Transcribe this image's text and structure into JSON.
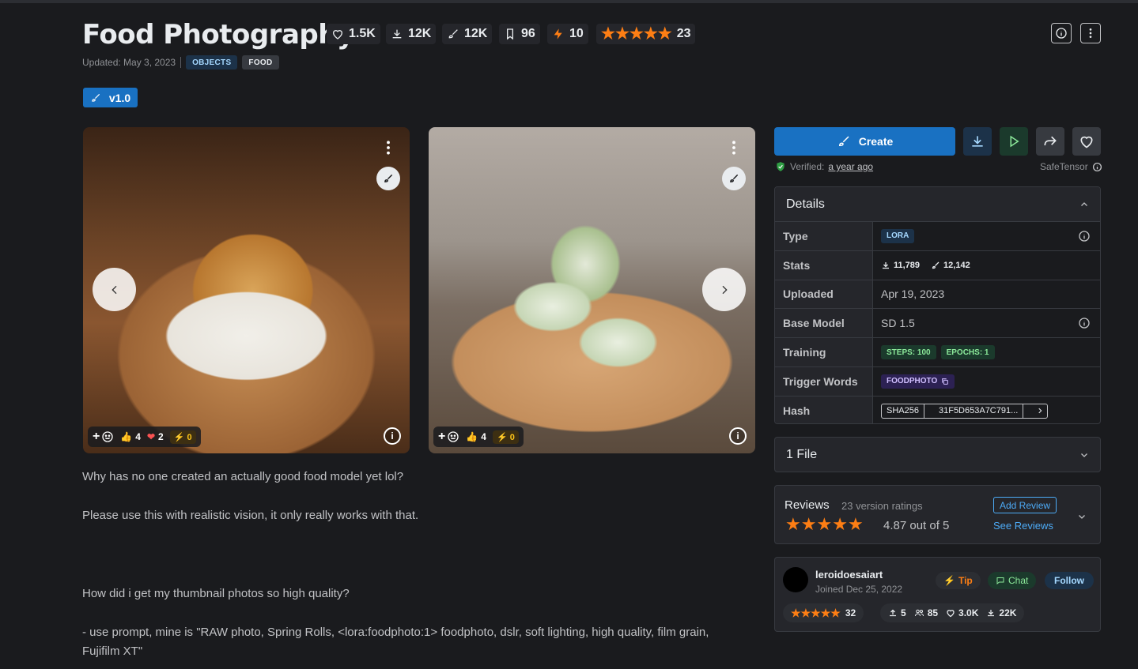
{
  "model": {
    "title": "Food Photography",
    "stats": {
      "likes": "1.5K",
      "downloads": "12K",
      "generations": "12K",
      "bookmarks": "96",
      "buzz": "10",
      "rating_count": "23"
    },
    "updated": "Updated: May 3, 2023",
    "tags": [
      "OBJECTS",
      "FOOD"
    ],
    "version": "v1.0"
  },
  "gallery": {
    "images": [
      {
        "alt": "waffle stack",
        "reactions": {
          "likes": "4",
          "hearts": "2",
          "buzz": "0"
        }
      },
      {
        "alt": "spring rolls",
        "reactions": {
          "likes": "4",
          "buzz": "0"
        }
      }
    ]
  },
  "description": {
    "p1": "Why has no one created an actually good food model yet lol?",
    "p2": "Please use this with realistic vision, it only really works with that.",
    "p3": "How did i get my thumbnail photos so high quality?",
    "p4": "- use prompt, mine is \"RAW photo, Spring Rolls, <lora:foodphoto:1> foodphoto, dslr, soft lighting, high quality, film grain, Fujifilm XT\""
  },
  "actions": {
    "create_label": "Create",
    "verified_label": "Verified:",
    "verified_time": "a year ago",
    "safetensor": "SafeTensor"
  },
  "details": {
    "heading": "Details",
    "type_label": "Type",
    "type_value": "LORA",
    "stats_label": "Stats",
    "stats_downloads": "11,789",
    "stats_generations": "12,142",
    "uploaded_label": "Uploaded",
    "uploaded_value": "Apr 19, 2023",
    "base_label": "Base Model",
    "base_value": "SD 1.5",
    "training_label": "Training",
    "training_steps": "STEPS: 100",
    "training_epochs": "EPOCHS: 1",
    "trigger_label": "Trigger Words",
    "trigger_value": "FOODPHOTO",
    "hash_label": "Hash",
    "hash_type": "SHA256",
    "hash_value": "31F5D653A7C791..."
  },
  "files": {
    "label": "1 File"
  },
  "reviews": {
    "label": "Reviews",
    "ratings_count": "23 version ratings",
    "score": "4.87 out of 5",
    "add_review": "Add Review",
    "see_reviews": "See Reviews"
  },
  "creator": {
    "name": "leroidoesaiart",
    "joined": "Joined Dec 25, 2022",
    "tip": "Tip",
    "chat": "Chat",
    "follow": "Follow",
    "rating_count": "32",
    "uploads": "5",
    "followers": "85",
    "likes": "3.0K",
    "downloads": "22K"
  },
  "colors": {
    "accent": "#1971c2",
    "star": "#fd7e14",
    "bg": "#1a1b1e",
    "panel": "#25262b"
  }
}
